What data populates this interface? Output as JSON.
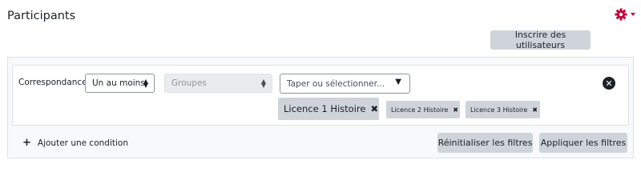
{
  "page": {
    "title": "Participants"
  },
  "actions_menu": {
    "icon": "gear-icon",
    "dropdown_icon": "caret-down-icon",
    "accent_color": "#c4003b"
  },
  "enrol_button": {
    "label": "Inscrire des utilisateurs"
  },
  "filter": {
    "match_label": "Correspondance",
    "match_select": {
      "value": "Un au moins"
    },
    "type_select": {
      "value": "Groupes"
    },
    "autocomplete": {
      "placeholder": "Taper ou sélectionner..."
    },
    "selected": [
      {
        "label": "Licence 1 Histoire"
      },
      {
        "label": "Licence 2 Histoire"
      },
      {
        "label": "Licence 3 Histoire"
      }
    ],
    "remove_icon": "times-circle-icon"
  },
  "add_condition": {
    "label": "Ajouter une condition"
  },
  "buttons": {
    "reset_label": "Réinitialiser les filtres",
    "apply_label": "Appliquer les filtres"
  }
}
